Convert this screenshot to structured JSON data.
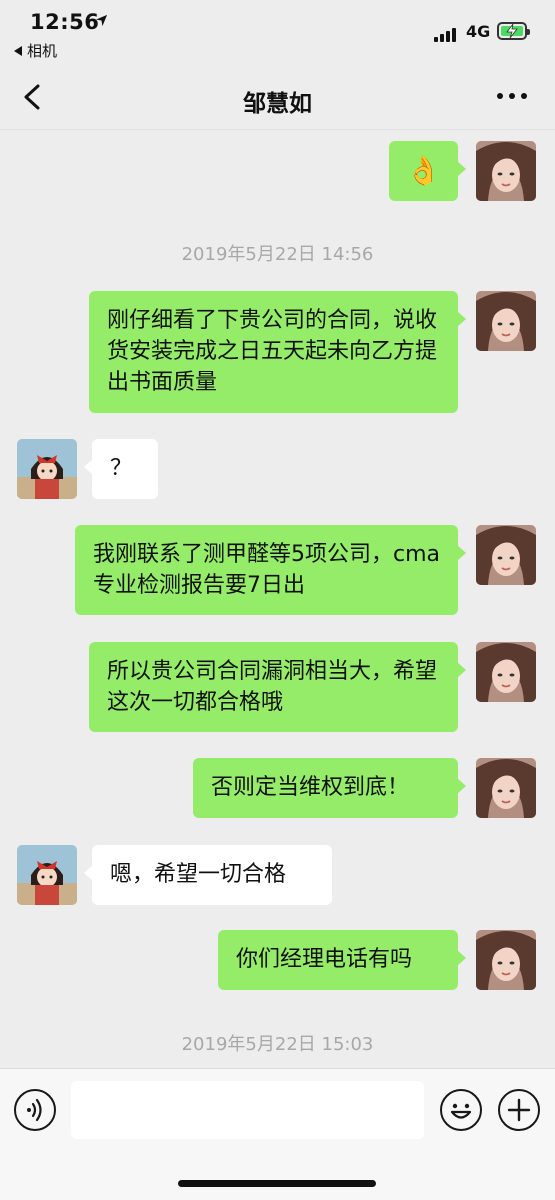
{
  "status_bar": {
    "time": "12:56",
    "back_app": "相机",
    "network": "4G"
  },
  "header": {
    "title": "邹慧如"
  },
  "messages": [
    {
      "sender": "me",
      "type": "emoji",
      "text": "👌"
    },
    {
      "sender": "me",
      "type": "text",
      "text": "刚仔细看了下贵公司的合同，说收货安装完成之日五天起未向乙方提出书面质量"
    },
    {
      "sender": "other",
      "type": "text",
      "text": "？"
    },
    {
      "sender": "me",
      "type": "text",
      "text": "我刚联系了测甲醛等5项公司，cma专业检测报告要7日出"
    },
    {
      "sender": "me",
      "type": "text",
      "text": "所以贵公司合同漏洞相当大，希望这次一切都合格哦"
    },
    {
      "sender": "me",
      "type": "text",
      "text": "否则定当维权到底！"
    },
    {
      "sender": "other",
      "type": "text",
      "text": "嗯，希望一切合格"
    },
    {
      "sender": "me",
      "type": "text",
      "text": "你们经理电话有吗"
    }
  ],
  "timestamps": [
    "2019年5月22日 14:56",
    "2019年5月22日 15:03"
  ],
  "colors": {
    "my_bubble": "#95ec69",
    "other_bubble": "#ffffff",
    "background": "#ededed"
  },
  "icons": [
    "location-arrow-icon",
    "signal-icon",
    "battery-icon",
    "back-chevron-icon",
    "more-icon",
    "voice-icon",
    "emoji-icon",
    "plus-icon"
  ]
}
